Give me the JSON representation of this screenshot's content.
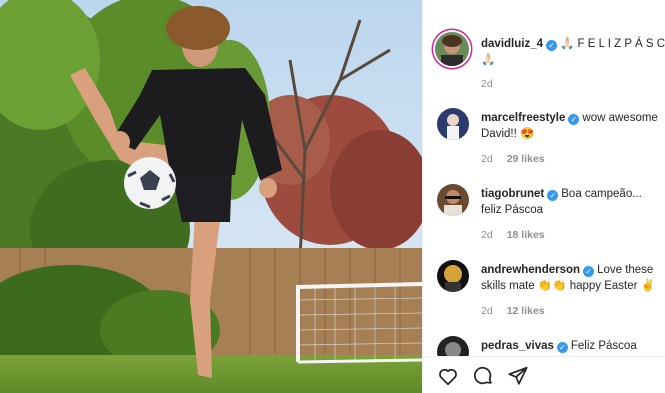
{
  "post": {
    "author": "davidluiz_4",
    "caption": "🙏🏻 F E L I Z P Á S C",
    "caption_line2": "🙏🏻",
    "time": "2d"
  },
  "comments": [
    {
      "user": "marcelfreestyle",
      "line1": "wow awesome",
      "line2": "David!! 😍",
      "time": "2d",
      "likes": "29 likes"
    },
    {
      "user": "tiagobrunet",
      "line1": "Boa campeão...",
      "line2": "feliz Páscoa",
      "time": "2d",
      "likes": "18 likes"
    },
    {
      "user": "andrewhenderson",
      "line1": "Love these",
      "line2": "skills mate 👏👏 happy Easter ✌️",
      "time": "2d",
      "likes": "12 likes"
    },
    {
      "user": "pedras_vivas",
      "line1": "Feliz Páscoa",
      "line2": "",
      "time": "",
      "likes": ""
    }
  ],
  "icons": {
    "like": "heart-icon",
    "comment": "comment-icon",
    "share": "share-icon",
    "verified": "verified-badge-icon"
  },
  "colors": {
    "verified": "#3897f0",
    "meta": "#8e8e8e",
    "text": "#262626"
  }
}
